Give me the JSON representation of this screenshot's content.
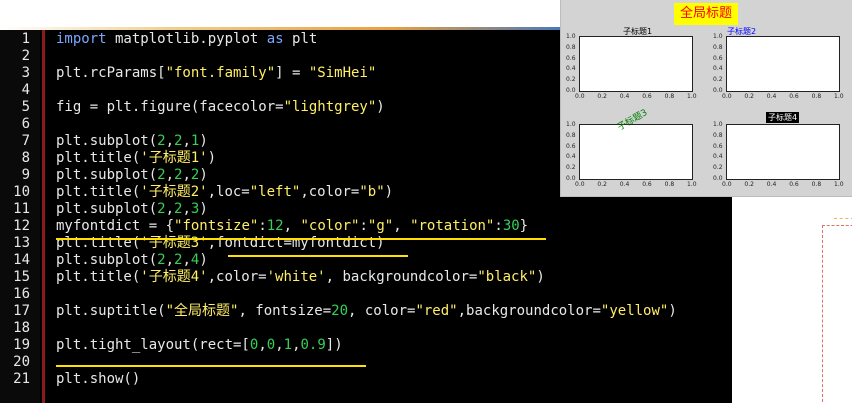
{
  "editor": {
    "lines": [
      {
        "n": "1",
        "t": "import matplotlib.pyplot as plt"
      },
      {
        "n": "2",
        "t": ""
      },
      {
        "n": "3",
        "t": "plt.rcParams[\"font.family\"] = \"SimHei\""
      },
      {
        "n": "4",
        "t": ""
      },
      {
        "n": "5",
        "t": "fig = plt.figure(facecolor=\"lightgrey\")"
      },
      {
        "n": "6",
        "t": ""
      },
      {
        "n": "7",
        "t": "plt.subplot(2,2,1)"
      },
      {
        "n": "8",
        "t": "plt.title('子标题1')"
      },
      {
        "n": "9",
        "t": "plt.subplot(2,2,2)"
      },
      {
        "n": "10",
        "t": "plt.title('子标题2',loc=\"left\",color=\"b\")"
      },
      {
        "n": "11",
        "t": "plt.subplot(2,2,3)"
      },
      {
        "n": "12",
        "t": "myfontdict = {\"fontsize\":12, \"color\":\"g\", \"rotation\":30}"
      },
      {
        "n": "13",
        "t": "plt.title('子标题3',fontdict=myfontdict)"
      },
      {
        "n": "14",
        "t": "plt.subplot(2,2,4)"
      },
      {
        "n": "15",
        "t": "plt.title('子标题4',color='white', backgroundcolor=\"black\")"
      },
      {
        "n": "16",
        "t": ""
      },
      {
        "n": "17",
        "t": "plt.suptitle(\"全局标题\", fontsize=20, color=\"red\",backgroundcolor=\"yellow\")"
      },
      {
        "n": "18",
        "t": ""
      },
      {
        "n": "19",
        "t": "plt.tight_layout(rect=[0,0,1,0.9])"
      },
      {
        "n": "20",
        "t": ""
      },
      {
        "n": "21",
        "t": "plt.show()"
      }
    ]
  },
  "figure": {
    "suptitle": "全局标题",
    "subplots": [
      {
        "title": "子标题1",
        "title_color": "#000000"
      },
      {
        "title": "子标题2",
        "title_color": "#0000ff"
      },
      {
        "title": "子标题3",
        "title_color": "#008000"
      },
      {
        "title": "子标题4",
        "title_color": "#ffffff",
        "title_bg": "#000000"
      }
    ],
    "yticks": [
      "1.0",
      "0.8",
      "0.6",
      "0.4",
      "0.2",
      "0.0"
    ],
    "xticks": [
      "0.0",
      "0.2",
      "0.4",
      "0.6",
      "0.8",
      "1.0"
    ]
  },
  "colors": {
    "keyword": "#7aa7ff",
    "string": "#ffee66",
    "number": "#34d058",
    "gutter_rule": "#8b1a1a",
    "highlight": "#ffe000"
  }
}
